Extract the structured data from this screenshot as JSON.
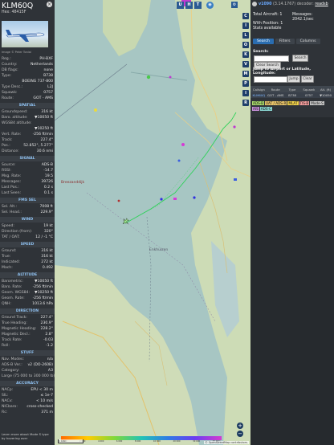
{
  "aircraft": {
    "callsign": "KLM60Q",
    "hex": "Hex: 48415F",
    "photo_credit": "Image © Peter Tonial"
  },
  "info": [
    {
      "k": "Reg.:",
      "v": "PH-BXF"
    },
    {
      "k": "Country:",
      "v": "Netherlands"
    },
    {
      "k": "DB flags:",
      "v": "none"
    },
    {
      "k": "Type:",
      "v": "B738"
    },
    {
      "k": "",
      "v": "BOEING 737-800"
    },
    {
      "k": "Type Desc.:",
      "v": "L2J"
    },
    {
      "k": "Squawk:",
      "v": "0757"
    },
    {
      "k": "Route:",
      "v": "GOT - AMS"
    }
  ],
  "sections": {
    "spatial": "SPATIAL",
    "signal": "SIGNAL",
    "fms": "FMS SEL",
    "wind": "WIND",
    "speed": "SPEED",
    "altitude": "ALTITUDE",
    "direction": "DIRECTION",
    "stuff": "STUFF",
    "accuracy": "ACCURACY"
  },
  "spatial": [
    {
      "k": "Groundspeed:",
      "v": "316 kt"
    },
    {
      "k": "Baro. altitude:",
      "v": "▼10050 ft"
    },
    {
      "k": "WGS84 altitude:",
      "v": ""
    },
    {
      "k": "",
      "v": "▼10250 ft"
    },
    {
      "k": "Vert. Rate:",
      "v": "-256 ft/min"
    },
    {
      "k": "Track:",
      "v": "227.4°"
    },
    {
      "k": "Pos.:",
      "v": "52.852°, 5.277°"
    },
    {
      "k": "Distance:",
      "v": "30.6 nmi"
    }
  ],
  "signal": [
    {
      "k": "Source:",
      "v": "ADS-B"
    },
    {
      "k": "RSSI:",
      "v": "-14.7"
    },
    {
      "k": "Msg. Rate:",
      "v": "19.5"
    },
    {
      "k": "Messages:",
      "v": "39726"
    },
    {
      "k": "Last Pos.:",
      "v": "0.2 s"
    },
    {
      "k": "Last Seen:",
      "v": "0.1 s"
    }
  ],
  "fms": [
    {
      "k": "Sel. Alt.:",
      "v": "7008 ft"
    },
    {
      "k": "Sel. Head.:",
      "v": "229.9°"
    }
  ],
  "wind": [
    {
      "k": "Speed:",
      "v": "19 kt"
    },
    {
      "k": "Direction (from):",
      "v": "320°"
    },
    {
      "k": "TAT / OAT:",
      "v": "12 / -1 °C"
    }
  ],
  "speed": [
    {
      "k": "Ground:",
      "v": "316 kt"
    },
    {
      "k": "True:",
      "v": "316 kt"
    },
    {
      "k": "Indicated:",
      "v": "272 kt"
    },
    {
      "k": "Mach:",
      "v": "0.492"
    }
  ],
  "altitude": [
    {
      "k": "Barometric:",
      "v": "▼10050 ft"
    },
    {
      "k": "Baro. Rate:",
      "v": "-256 ft/min"
    },
    {
      "k": "Geom. WGS84:",
      "v": "▼10250 ft"
    },
    {
      "k": "Geom. Rate:",
      "v": "-256 ft/min"
    },
    {
      "k": "QNH:",
      "v": "1013.6 hPa"
    }
  ],
  "direction": [
    {
      "k": "Ground Track:",
      "v": "227.4°"
    },
    {
      "k": "True Heading:",
      "v": "230.9°"
    },
    {
      "k": "Magnetic Heading:",
      "v": "228.2°"
    },
    {
      "k": "Magnetic Decl.:",
      "v": "2.8°"
    },
    {
      "k": "Track Rate:",
      "v": "-0.03"
    },
    {
      "k": "Roll:",
      "v": "-1.2"
    }
  ],
  "stuff": [
    {
      "k": "Nav. Modes:",
      "v": "n/a"
    },
    {
      "k": "ADS-B Ver.:",
      "v": "v2 (DO-260B)"
    },
    {
      "k": "Category:",
      "v": "A3"
    },
    {
      "k": "Large (75 000 to 300 000 lb)",
      "v": ""
    }
  ],
  "accuracy": [
    {
      "k": "NACp:",
      "v": "EPU < 30 m"
    },
    {
      "k": "SIL:",
      "v": "≤ 1e-7"
    },
    {
      "k": "NACv:",
      "v": "< 10 m/s"
    },
    {
      "k": "NICbaro:",
      "v": "cross-checked"
    },
    {
      "k": "Rc:",
      "v": "371 m"
    }
  ],
  "footer": "Learn more about Mode S type by hovering over",
  "map": {
    "labels": {
      "place1": "Breezanddijk",
      "place2": "Enkhuizen"
    },
    "top_buttons": [
      "U",
      "H",
      "T"
    ],
    "side_buttons": [
      "C",
      "I",
      "L",
      "O",
      "K",
      "V",
      "M",
      "P",
      "I",
      "R"
    ],
    "zoom_in": "+",
    "zoom_out": "−",
    "scale": "1 nmi",
    "attribution": "© OpenStreetMap contributors.",
    "legend_ticks": [
      "1 000",
      "2 000",
      "4 000",
      "6 000",
      "8 000",
      "10 000",
      "20 000",
      "30 000",
      "40 000+"
    ]
  },
  "right": {
    "version_prefix": "v1090",
    "version_rest": " (3.14.1767) decoder: ",
    "version_link": "readsb",
    "total_aircraft": "Total Aircraft: 1",
    "with_position": "With Position: 1",
    "stats": "Stats available",
    "messages_label": "Messages:",
    "messages_rate": "2042.1/sec",
    "tabs": [
      "Search",
      "Filters",
      "Columns"
    ],
    "search_label": "Search:",
    "search_button": "Search",
    "clear_search": "Clear Search",
    "jump_label": "Jump to Airport or Latitude, Longitude:",
    "jump_button": "Jump",
    "clear_button": "Clear",
    "columns": [
      "Callsign",
      "Route",
      "Type",
      "Squawk",
      "Alt. (ft)"
    ],
    "row": [
      "KLM60Q",
      "GOT - AMS",
      "B738",
      "0757",
      "▼10050"
    ],
    "chips": [
      "ADS-B",
      "UAT / ADS-R",
      "MLAT",
      "TIS-B",
      "Mode-S",
      "AIS",
      "ADS-C"
    ]
  },
  "colors": {
    "accent": "#2a6db0",
    "chip_adsb": "#a8d96b",
    "chip_uat": "#e8c36a",
    "chip_mlat": "#f2d24b",
    "chip_tisb": "#f09b9b",
    "chip_modes": "#c8c8c8",
    "chip_ais": "#c68fd9",
    "chip_adsc": "#89d4d0"
  }
}
